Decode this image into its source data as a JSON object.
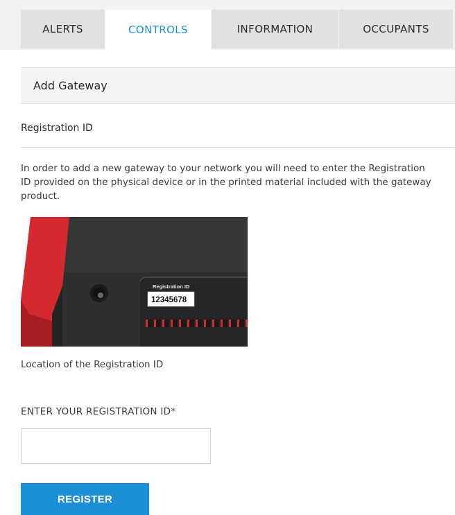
{
  "tabs": [
    {
      "label": "ALERTS",
      "active": false
    },
    {
      "label": "CONTROLS",
      "active": true
    },
    {
      "label": "INFORMATION",
      "active": false
    },
    {
      "label": "OCCUPANTS",
      "active": false
    }
  ],
  "section": {
    "title": "Add Gateway",
    "subheading": "Registration ID",
    "instructions": "In order to add a new gateway to your network you will need to enter the Registration ID provided on the physical device or in the printed material included with the gateway product."
  },
  "device_image": {
    "label_title": "Registration ID",
    "label_value": "12345678",
    "caption": "Location of the Registration ID"
  },
  "form": {
    "field_label": "ENTER YOUR REGISTRATION ID*",
    "value": "",
    "placeholder": "",
    "submit_label": "REGISTER"
  },
  "colors": {
    "accent": "#1c8fd6",
    "device_red": "#d42a2f",
    "device_body": "#2f2f2f"
  }
}
